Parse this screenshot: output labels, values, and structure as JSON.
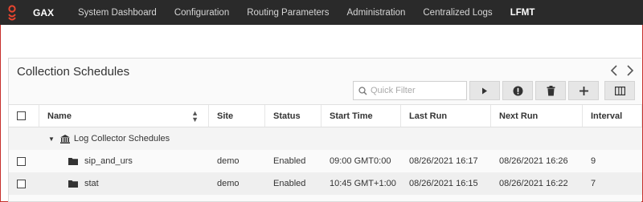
{
  "app": {
    "brand": "GAX"
  },
  "nav": {
    "items": [
      {
        "label": "System Dashboard"
      },
      {
        "label": "Configuration"
      },
      {
        "label": "Routing Parameters"
      },
      {
        "label": "Administration"
      },
      {
        "label": "Centralized Logs"
      },
      {
        "label": "LFMT"
      }
    ],
    "active": "LFMT"
  },
  "panel": {
    "title": "Collection Schedules"
  },
  "filter": {
    "placeholder": "Quick Filter",
    "value": ""
  },
  "toolbar": {
    "buttons": [
      "play-icon",
      "alert-circle-icon",
      "trash-icon",
      "plus-icon",
      "columns-icon"
    ]
  },
  "table": {
    "columns": [
      "Name",
      "Site",
      "Status",
      "Start Time",
      "Last Run",
      "Next Run",
      "Interval"
    ],
    "group": {
      "label": "Log Collector Schedules",
      "expanded": true
    },
    "rows": [
      {
        "name": "sip_and_urs",
        "site": "demo",
        "status": "Enabled",
        "start_time": "09:00 GMT0:00",
        "last_run": "08/26/2021 16:17",
        "next_run": "08/26/2021 16:26",
        "interval": "9"
      },
      {
        "name": "stat",
        "site": "demo",
        "status": "Enabled",
        "start_time": "10:45 GMT+1:00",
        "last_run": "08/26/2021 16:15",
        "next_run": "08/26/2021 16:22",
        "interval": "7"
      }
    ]
  },
  "colors": {
    "topbar": "#2a2a2a",
    "accent_border": "#c7302c",
    "logo": "#e8452f"
  }
}
